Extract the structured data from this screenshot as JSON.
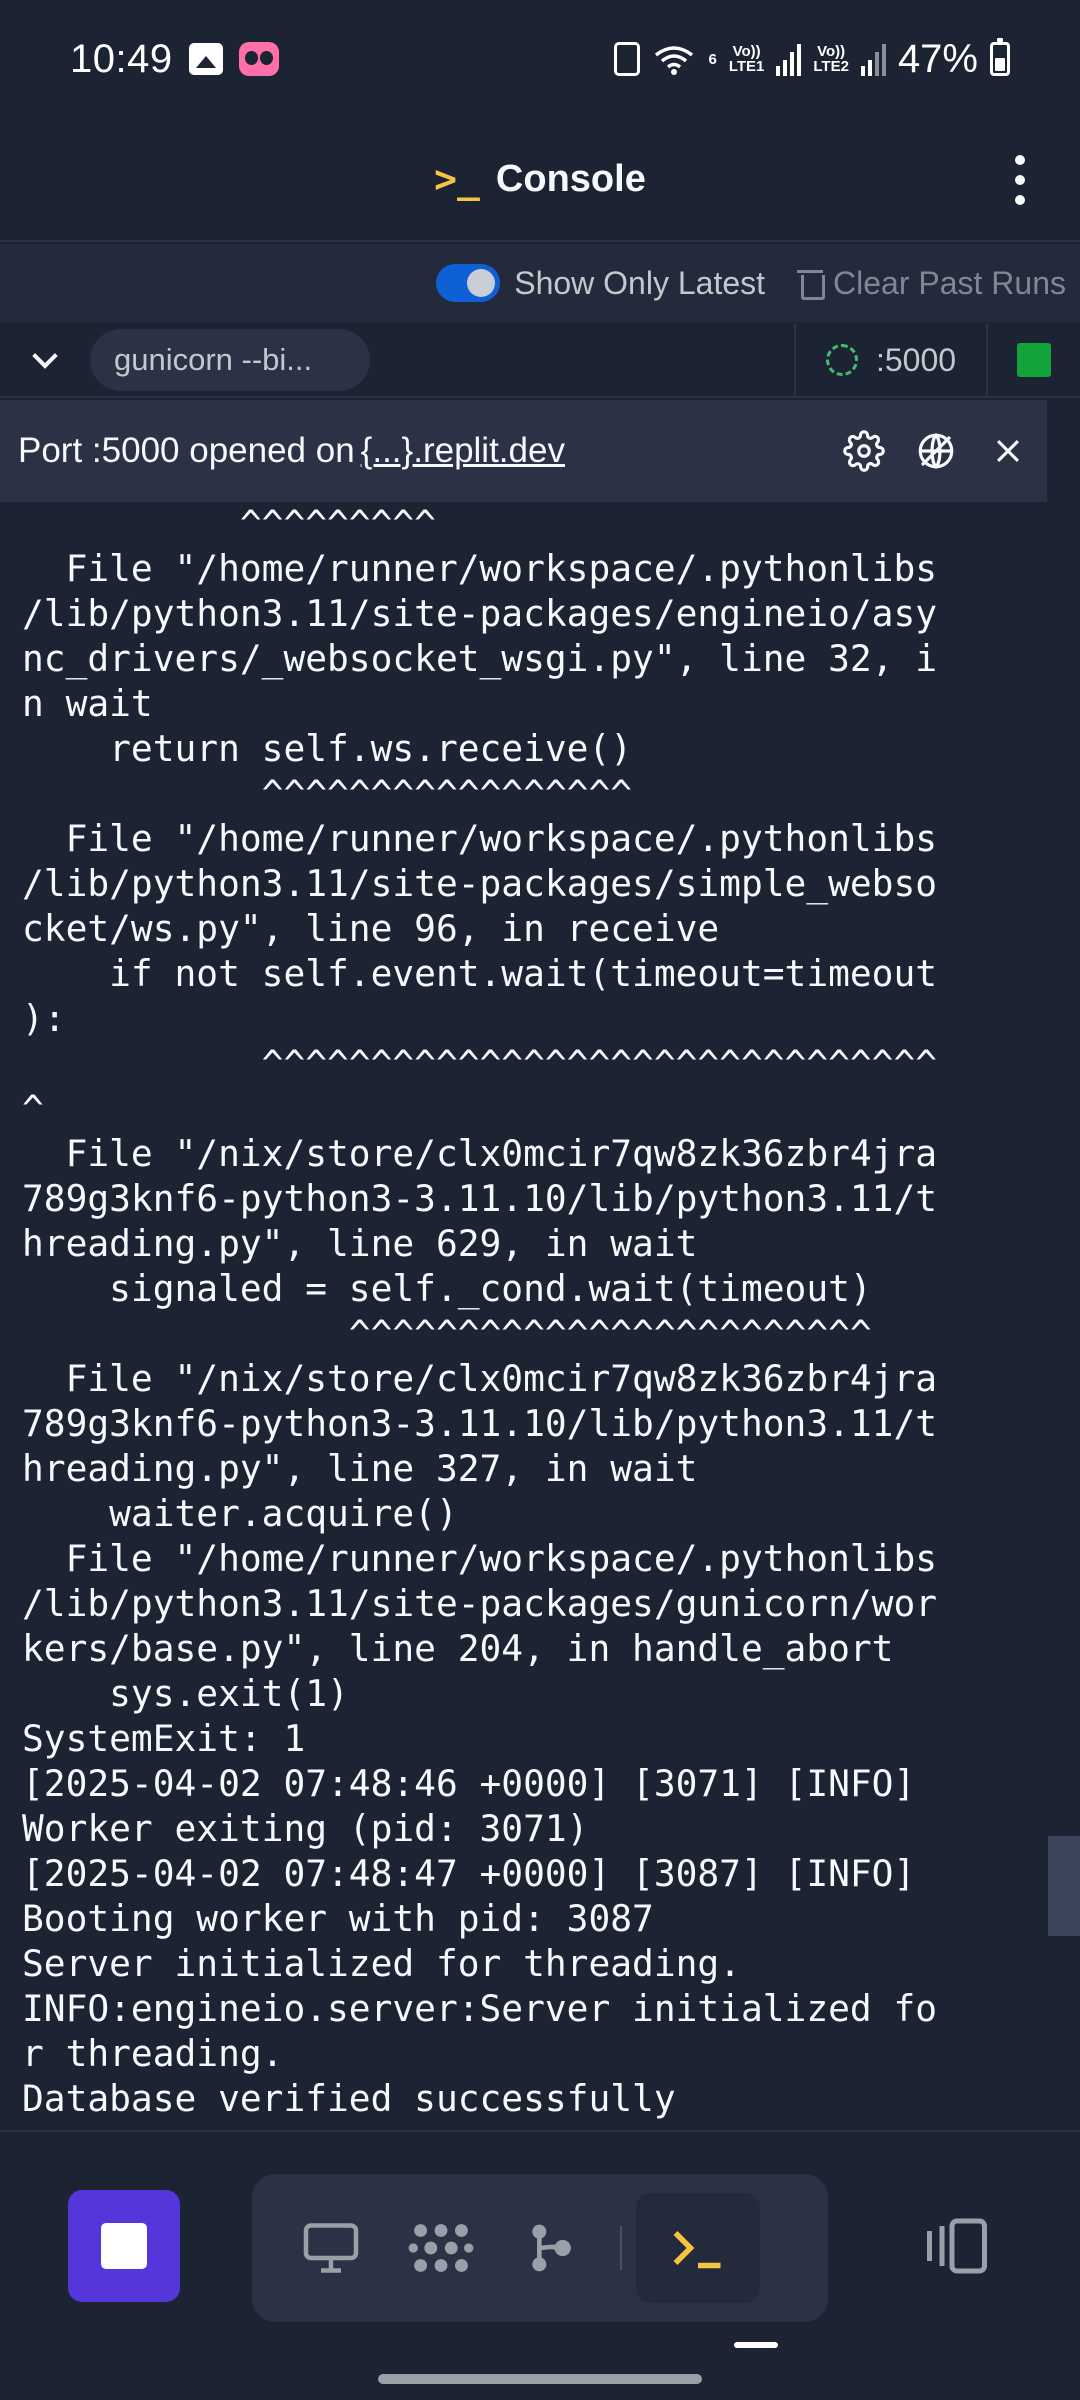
{
  "status_bar": {
    "time": "10:49",
    "network_labels": [
      "Vo))",
      "LTE1",
      "Vo))",
      "LTE2"
    ],
    "wifi_badge": "6",
    "battery": "47%"
  },
  "header": {
    "prompt_glyph": ">_",
    "title": "Console",
    "menu_icon": "more-vertical-icon"
  },
  "toolbar": {
    "toggle_label": "Show Only Latest",
    "toggle_on": true,
    "clear_label": "Clear Past Runs"
  },
  "run_row": {
    "command": "gunicorn --bi...",
    "port": ":5000",
    "status_color": "#12a33a"
  },
  "port_banner": {
    "text": "Port :5000 opened on",
    "link": "{...}.replit.dev"
  },
  "console": {
    "lines": [
      "          ^^^^^^^^^",
      "  File \"/home/runner/workspace/.pythonlibs",
      "/lib/python3.11/site-packages/engineio/asy",
      "nc_drivers/_websocket_wsgi.py\", line 32, i",
      "n wait",
      "    return self.ws.receive()",
      "           ^^^^^^^^^^^^^^^^^",
      "  File \"/home/runner/workspace/.pythonlibs",
      "/lib/python3.11/site-packages/simple_webso",
      "cket/ws.py\", line 96, in receive",
      "    if not self.event.wait(timeout=timeout",
      "):",
      "           ^^^^^^^^^^^^^^^^^^^^^^^^^^^^^^^",
      "^",
      "  File \"/nix/store/clx0mcir7qw8zk36zbr4jra",
      "789g3knf6-python3-3.11.10/lib/python3.11/t",
      "hreading.py\", line 629, in wait",
      "    signaled = self._cond.wait(timeout)",
      "               ^^^^^^^^^^^^^^^^^^^^^^^^",
      "  File \"/nix/store/clx0mcir7qw8zk36zbr4jra",
      "789g3knf6-python3-3.11.10/lib/python3.11/t",
      "hreading.py\", line 327, in wait",
      "    waiter.acquire()",
      "  File \"/home/runner/workspace/.pythonlibs",
      "/lib/python3.11/site-packages/gunicorn/wor",
      "kers/base.py\", line 204, in handle_abort",
      "    sys.exit(1)",
      "SystemExit: 1",
      "[2025-04-02 07:48:46 +0000] [3071] [INFO]",
      "Worker exiting (pid: 3071)",
      "[2025-04-02 07:48:47 +0000] [3087] [INFO]",
      "Booting worker with pid: 3087",
      "Server initialized for threading.",
      "INFO:engineio.server:Server initialized fo",
      "r threading.",
      "Database verified successfully"
    ]
  },
  "bottom_bar": {
    "stop_button": "stop-icon",
    "dock_items": [
      "webview-icon",
      "packages-icon",
      "git-icon",
      "console-icon"
    ],
    "active_item": "console-icon",
    "right_icon": "layout-switch-icon"
  }
}
